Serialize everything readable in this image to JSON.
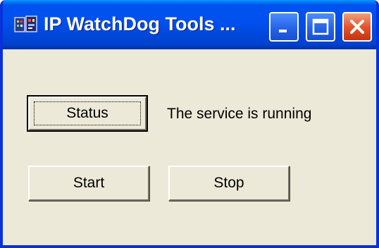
{
  "window": {
    "title": "IP WatchDog Tools ...",
    "icon": "app-icon",
    "caption_buttons": {
      "minimize_icon": "minimize-icon",
      "maximize_icon": "maximize-icon",
      "close_icon": "close-icon"
    },
    "colors": {
      "titlebar": "#0053ee",
      "face": "#ece9d8",
      "close": "#e4552c"
    }
  },
  "main": {
    "status_button": "Status",
    "status_text": "The service is running",
    "start_button": "Start",
    "stop_button": "Stop"
  }
}
